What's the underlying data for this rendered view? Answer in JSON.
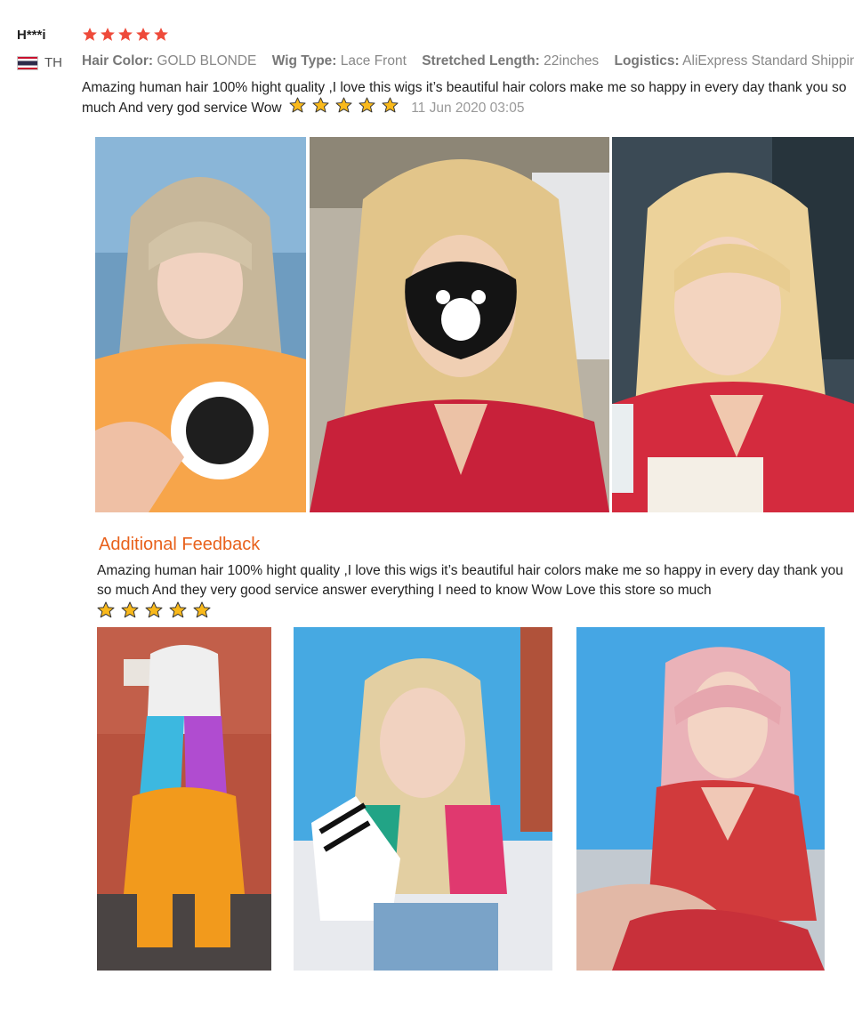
{
  "review": {
    "user": "H***i",
    "country": "TH",
    "rating": 5,
    "attributes": [
      {
        "key": "Hair Color:",
        "value": "GOLD BLONDE"
      },
      {
        "key": "Wig Type:",
        "value": "Lace Front"
      },
      {
        "key": "Stretched Length:",
        "value": "22inches"
      },
      {
        "key": "Logistics:",
        "value": "AliExpress Standard Shipping"
      }
    ],
    "text": "Amazing human hair 100% hight quality ,I love this wigs it’s beautiful hair colors make me so happy in every day thank you so much And very god service Wow",
    "date": "11 Jun 2020 03:05"
  },
  "additional": {
    "title": "Additional Feedback",
    "text": "Amazing human hair 100% hight quality ,I love this wigs it’s beautiful hair colors make me so happy in every day thank you so much And they very good service answer everything I need to know Wow Love this store so much"
  },
  "colors": {
    "rating_star": "#ee4a3a",
    "emoji_star": "#f9b91b",
    "feedback_title": "#e8611c"
  },
  "icons": {
    "flag": "thailand-flag-icon",
    "star": "star-icon"
  }
}
